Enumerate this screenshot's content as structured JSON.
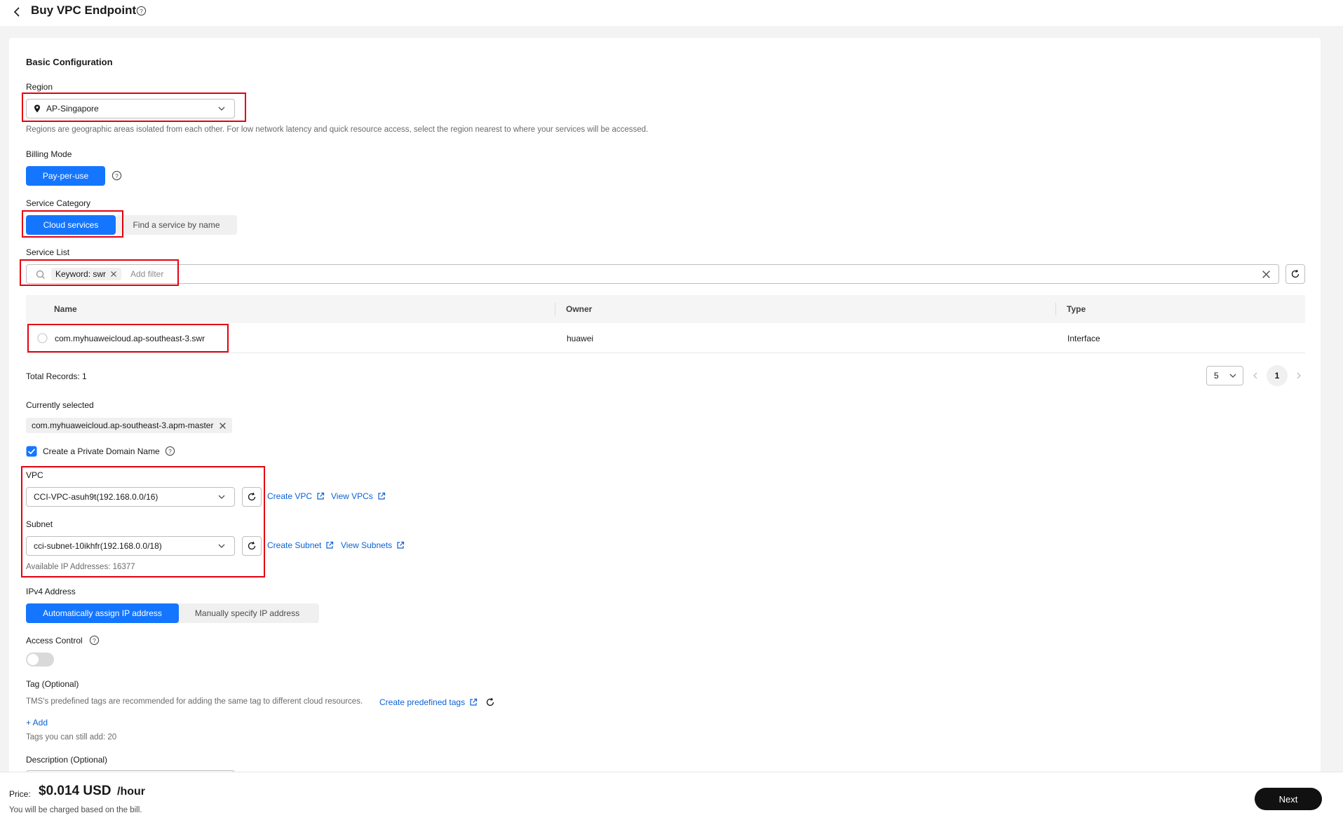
{
  "header": {
    "title": "Buy VPC Endpoint"
  },
  "basic": {
    "section_title": "Basic Configuration",
    "region_label": "Region",
    "region_value": "AP-Singapore",
    "region_hint": "Regions are geographic areas isolated from each other. For low network latency and quick resource access, select the region nearest to where your services will be accessed.",
    "billing_label": "Billing Mode",
    "billing_value": "Pay-per-use",
    "service_category_label": "Service Category",
    "service_category_options": [
      "Cloud services",
      "Find a service by name"
    ],
    "service_list_label": "Service List",
    "filter_tag": "Keyword: swr",
    "filter_placeholder": "Add filter"
  },
  "table": {
    "columns": [
      "Name",
      "Owner",
      "Type"
    ],
    "rows": [
      {
        "name": "com.myhuaweicloud.ap-southeast-3.swr",
        "owner": "huawei",
        "type": "Interface"
      }
    ],
    "total_records": "Total Records: 1",
    "page_size": "5",
    "current_page": "1"
  },
  "selection": {
    "currently_selected_label": "Currently selected",
    "selected_item": "com.myhuaweicloud.ap-southeast-3.apm-master",
    "private_domain_label": "Create a Private Domain Name",
    "private_domain_checked": true
  },
  "network": {
    "vpc_label": "VPC",
    "vpc_value": "CCI-VPC-asuh9t(192.168.0.0/16)",
    "create_vpc": "Create VPC",
    "view_vpcs": "View VPCs",
    "subnet_label": "Subnet",
    "subnet_value": "cci-subnet-10ikhfr(192.168.0.0/18)",
    "create_subnet": "Create Subnet",
    "view_subnets": "View Subnets",
    "available_ips": "Available IP Addresses: 16377"
  },
  "ipv4": {
    "label": "IPv4 Address",
    "options": [
      "Automatically assign IP address",
      "Manually specify IP address"
    ]
  },
  "access_control": {
    "label": "Access Control",
    "enabled": false
  },
  "tags": {
    "label": "Tag (Optional)",
    "hint": "TMS's predefined tags are recommended for adding the same tag to different cloud resources.",
    "create_link": "Create predefined tags",
    "add": "+ Add",
    "remaining": "Tags you can still add: 20"
  },
  "description": {
    "label": "Description (Optional)"
  },
  "footer": {
    "price_label": "Price:",
    "price_value": "$0.014 USD",
    "price_unit": "/hour",
    "note": "You will be charged based on the bill.",
    "next": "Next"
  },
  "colors": {
    "primary": "#1476ff",
    "highlight": "#e4000f",
    "link": "#0b62d6",
    "next_button": "#111111"
  }
}
